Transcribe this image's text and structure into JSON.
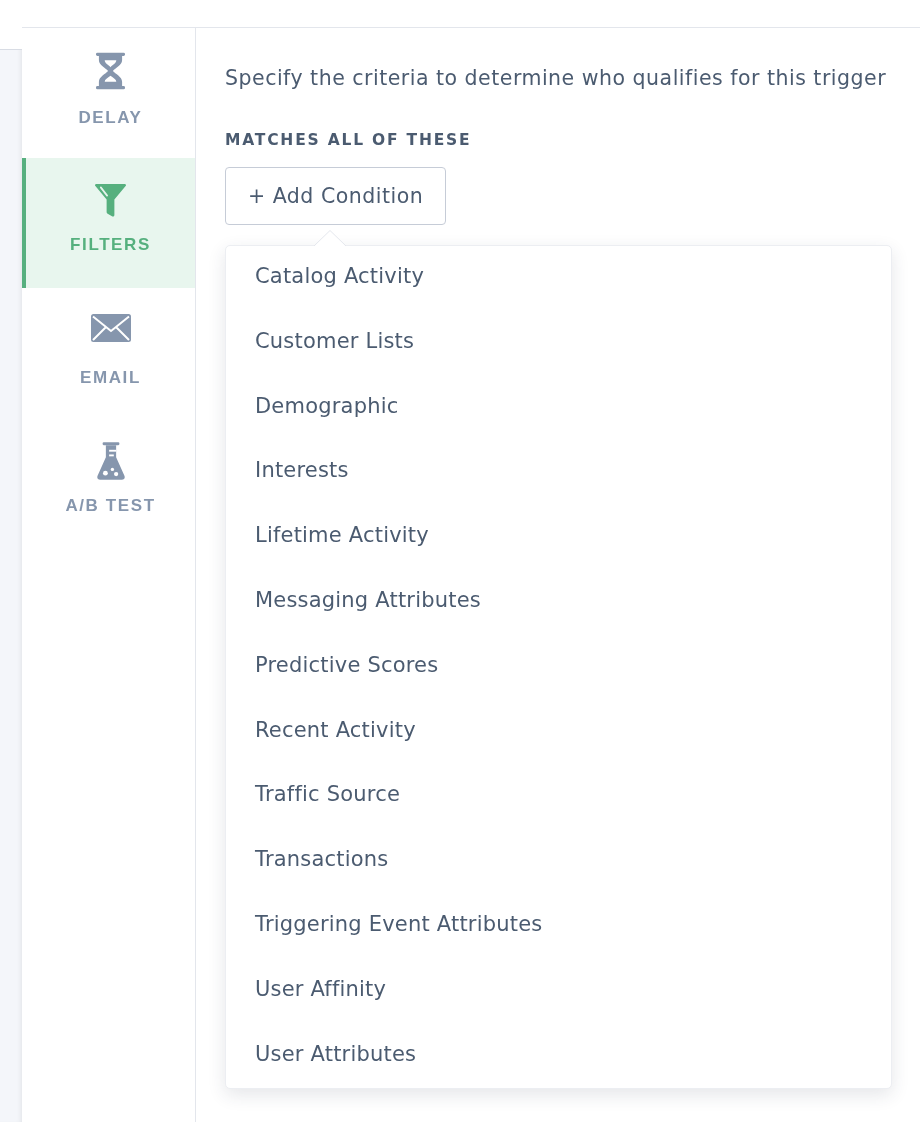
{
  "sidebar": {
    "items": [
      {
        "label": "DELAY",
        "selected": false
      },
      {
        "label": "FILTERS",
        "selected": true
      },
      {
        "label": "EMAIL",
        "selected": false
      },
      {
        "label": "A/B TEST",
        "selected": false
      }
    ]
  },
  "main": {
    "description": "Specify the criteria to determine who qualifies for this trigger",
    "section_heading": "MATCHES ALL OF THESE",
    "add_button": {
      "label": "+ Add Condition",
      "expanded": true
    },
    "dropdown": {
      "items": [
        "Catalog Activity",
        "Customer Lists",
        "Demographic",
        "Interests",
        "Lifetime Activity",
        "Messaging Attributes",
        "Predictive Scores",
        "Recent Activity",
        "Traffic Source",
        "Transactions",
        "Triggering Event Attributes",
        "User Affinity",
        "User Attributes"
      ]
    }
  }
}
